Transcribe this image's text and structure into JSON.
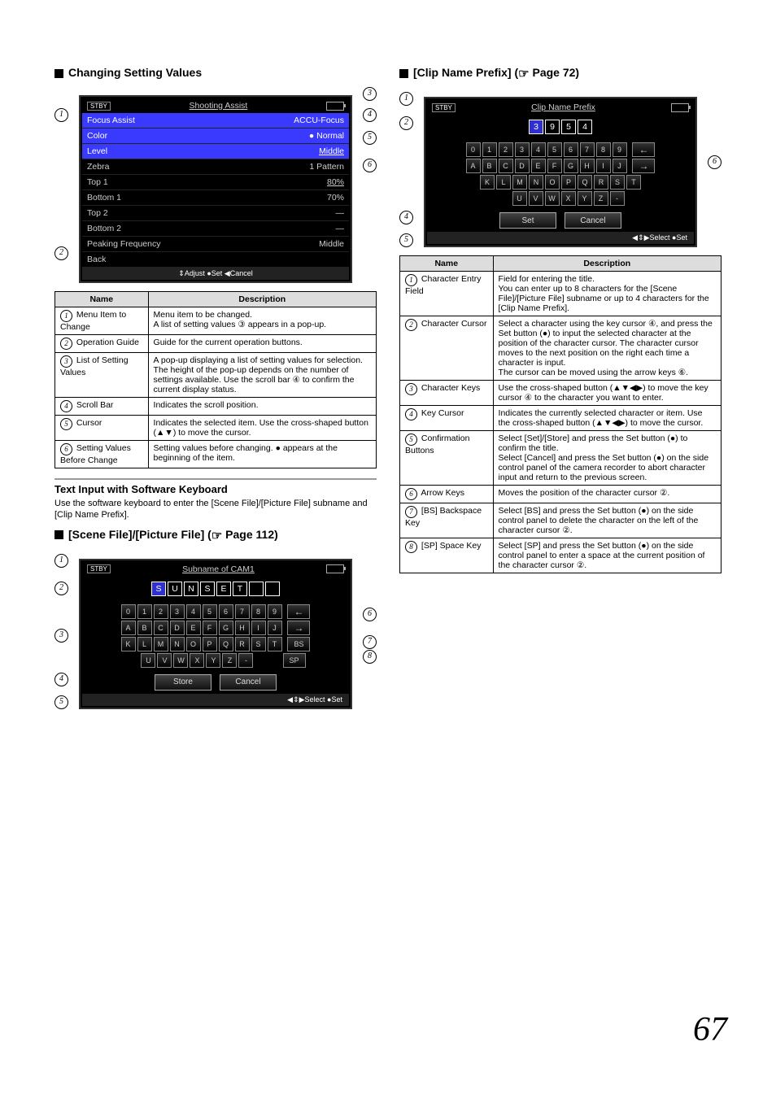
{
  "left": {
    "h1": "Changing Setting Values",
    "menu": {
      "stby": "STBY",
      "title": "Shooting Assist",
      "rows": [
        [
          "Focus Assist",
          "ACCU-Focus"
        ],
        [
          "Color",
          "● Normal"
        ],
        [
          "Level",
          "Middle"
        ],
        [
          "Zebra",
          "1 Pattern"
        ],
        [
          "Top 1",
          "80%"
        ],
        [
          "Bottom 1",
          "70%"
        ],
        [
          "Top 2",
          "—"
        ],
        [
          "Bottom 2",
          "—"
        ],
        [
          "Peaking Frequency",
          "Middle"
        ],
        [
          "Back",
          ""
        ]
      ],
      "ops": "⇕Adjust    ●Set    ◀Cancel"
    },
    "table": {
      "hName": "Name",
      "hDesc": "Description",
      "r1n": "Menu Item to Change",
      "r1d": "Menu item to be changed.\nA list of setting values ③ appears in a pop-up.",
      "r2n": "Operation Guide",
      "r2d": "Guide for the current operation buttons.",
      "r3n": "List of Setting Values",
      "r3d": "A pop-up displaying a list of setting values for selection.\nThe height of the pop-up depends on the number of settings available. Use the scroll bar ④ to confirm the current display status.",
      "r4n": "Scroll Bar",
      "r4d": "Indicates the scroll position.",
      "r5n": "Cursor",
      "r5d": "Indicates the selected item. Use the cross-shaped button (▲▼) to move the cursor.",
      "r6n": "Setting Values Before Change",
      "r6d": "Setting values before changing. ● appears at the beginning of the item."
    },
    "subH": "Text Input with Software Keyboard",
    "subTxt": "Use the software keyboard to enter the [Scene File]/[Picture File] subname and [Clip Name Prefix].",
    "h2_pre": "[Scene File]/[Picture File] (",
    "h2_page": " Page 112)",
    "kb1": {
      "title": "Subname of CAM1",
      "field": [
        "S",
        "U",
        "N",
        "S",
        "E",
        "T",
        "",
        ""
      ],
      "rows": [
        [
          "0",
          "1",
          "2",
          "3",
          "4",
          "5",
          "6",
          "7",
          "8",
          "9"
        ],
        [
          "A",
          "B",
          "C",
          "D",
          "E",
          "F",
          "G",
          "H",
          "I",
          "J"
        ],
        [
          "K",
          "L",
          "M",
          "N",
          "O",
          "P",
          "Q",
          "R",
          "S",
          "T"
        ],
        [
          "U",
          "V",
          "W",
          "X",
          "Y",
          "Z",
          "-",
          "",
          "",
          ""
        ]
      ],
      "arrows": [
        "←",
        "→"
      ],
      "extra": [
        "BS",
        "SP"
      ],
      "btn1": "Store",
      "btn2": "Cancel",
      "ops2": "◀⇕▶Select   ●Set"
    }
  },
  "right": {
    "h1_pre": "[Clip Name Prefix] (",
    "h1_page": " Page 72)",
    "kb2": {
      "title": "Clip Name Prefix",
      "field": [
        "3",
        "9",
        "5",
        "4"
      ],
      "rows": [
        [
          "0",
          "1",
          "2",
          "3",
          "4",
          "5",
          "6",
          "7",
          "8",
          "9"
        ],
        [
          "A",
          "B",
          "C",
          "D",
          "E",
          "F",
          "G",
          "H",
          "I",
          "J"
        ],
        [
          "K",
          "L",
          "M",
          "N",
          "O",
          "P",
          "Q",
          "R",
          "S",
          "T"
        ],
        [
          "U",
          "V",
          "W",
          "X",
          "Y",
          "Z",
          "-",
          "",
          "",
          ""
        ]
      ],
      "arrows": [
        "←",
        "→"
      ],
      "btn1": "Set",
      "btn2": "Cancel",
      "ops2": "◀⇕▶Select   ●Set"
    },
    "table": {
      "hName": "Name",
      "hDesc": "Description",
      "r1n": "Character Entry Field",
      "r1d": "Field for entering the title.\nYou can enter up to 8 characters for the [Scene File]/[Picture File] subname or up to 4 characters for the [Clip Name Prefix].",
      "r2n": "Character Cursor",
      "r2d": "Select a character using the key cursor ④, and press the Set button (●) to input the selected character at the position of the character cursor. The character cursor moves to the next position on the right each time a character is input.\nThe cursor can be moved using the arrow keys ⑥.",
      "r3n": "Character Keys",
      "r3d": "Use the cross-shaped button (▲▼◀▶) to move the key cursor ④ to the character you want to enter.",
      "r4n": "Key Cursor",
      "r4d": "Indicates the currently selected character or item. Use the cross-shaped button (▲▼◀▶) to move the cursor.",
      "r5n": "Confirmation Buttons",
      "r5d": "Select [Set]/[Store] and press the Set button (●) to confirm the title.\nSelect [Cancel] and press the Set button (●) on the side control panel of the camera recorder to abort character input and return to the previous screen.",
      "r6n": "Arrow Keys",
      "r6d": "Moves the position of the character cursor ②.",
      "r7n": "[BS] Backspace Key",
      "r7d": "Select [BS] and press the Set button (●) on the side control panel to delete the character on the left of the character cursor ②.",
      "r8n": "[SP] Space Key",
      "r8d": "Select [SP] and press the Set button (●) on the side control panel to enter a space at the current position of the character cursor ②."
    }
  },
  "pageNum": "67"
}
